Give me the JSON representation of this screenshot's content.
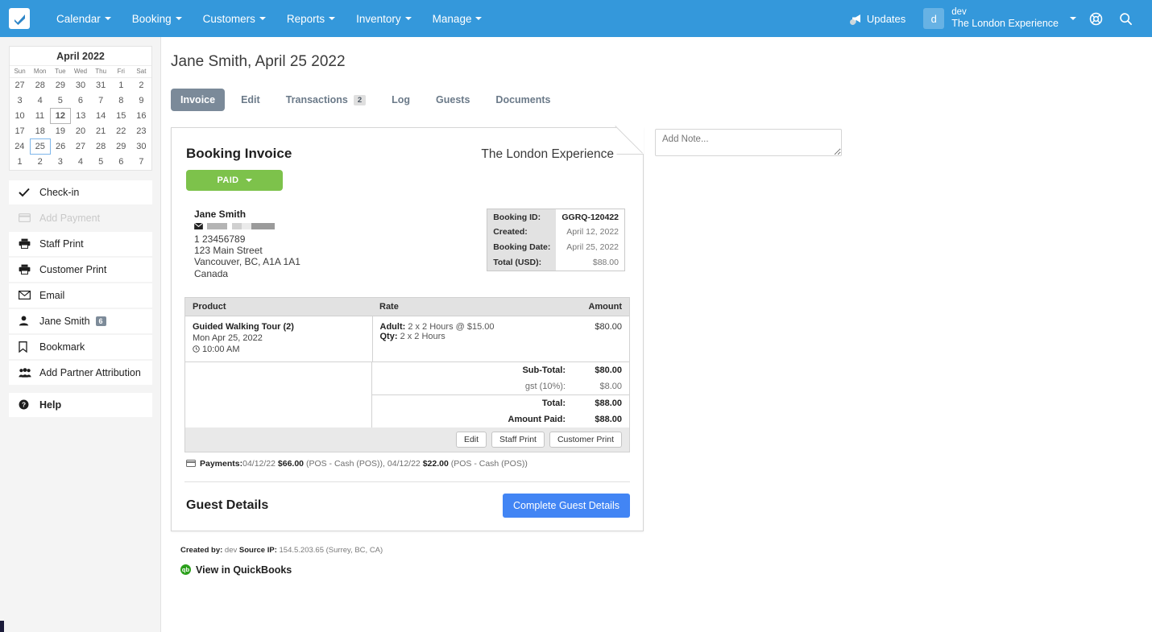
{
  "topnav": {
    "logo_icon": "checkmark-logo",
    "items": [
      {
        "label": "Calendar",
        "caret": true
      },
      {
        "label": "Booking",
        "caret": true
      },
      {
        "label": "Customers",
        "caret": true
      },
      {
        "label": "Reports",
        "caret": true
      },
      {
        "label": "Inventory",
        "caret": true
      },
      {
        "label": "Manage",
        "caret": true
      }
    ],
    "updates_label": "Updates",
    "updates_icon": "megaphone-icon",
    "avatar_initial": "d",
    "user_name": "dev",
    "user_org": "The London Experience",
    "globe_icon": "globe-help-icon",
    "search_icon": "search-icon",
    "background": "#3498db"
  },
  "sidebar": {
    "calendar": {
      "title": "April 2022",
      "weekdays": [
        "Sun",
        "Mon",
        "Tue",
        "Wed",
        "Thu",
        "Fri",
        "Sat"
      ],
      "weeks": [
        [
          {
            "d": "27"
          },
          {
            "d": "28"
          },
          {
            "d": "29"
          },
          {
            "d": "30"
          },
          {
            "d": "31"
          },
          {
            "d": "1"
          },
          {
            "d": "2"
          }
        ],
        [
          {
            "d": "3"
          },
          {
            "d": "4"
          },
          {
            "d": "5"
          },
          {
            "d": "6"
          },
          {
            "d": "7"
          },
          {
            "d": "8"
          },
          {
            "d": "9"
          }
        ],
        [
          {
            "d": "10"
          },
          {
            "d": "11"
          },
          {
            "d": "12",
            "state": "today"
          },
          {
            "d": "13"
          },
          {
            "d": "14"
          },
          {
            "d": "15"
          },
          {
            "d": "16"
          }
        ],
        [
          {
            "d": "17"
          },
          {
            "d": "18"
          },
          {
            "d": "19"
          },
          {
            "d": "20"
          },
          {
            "d": "21"
          },
          {
            "d": "22"
          },
          {
            "d": "23"
          }
        ],
        [
          {
            "d": "24"
          },
          {
            "d": "25",
            "state": "selected"
          },
          {
            "d": "26"
          },
          {
            "d": "27"
          },
          {
            "d": "28"
          },
          {
            "d": "29"
          },
          {
            "d": "30"
          }
        ],
        [
          {
            "d": "1"
          },
          {
            "d": "2"
          },
          {
            "d": "3"
          },
          {
            "d": "4"
          },
          {
            "d": "5"
          },
          {
            "d": "6"
          },
          {
            "d": "7"
          }
        ]
      ]
    },
    "items": [
      {
        "label": "Check-in",
        "icon": "check-icon",
        "disabled": false
      },
      {
        "label": "Add Payment",
        "icon": "credit-card-icon",
        "disabled": true
      },
      {
        "label": "Staff Print",
        "icon": "printer-icon",
        "disabled": false
      },
      {
        "label": "Customer Print",
        "icon": "printer-icon",
        "disabled": false
      },
      {
        "label": "Email",
        "icon": "envelope-icon",
        "disabled": false
      },
      {
        "label": "Jane Smith",
        "icon": "user-icon",
        "disabled": false,
        "badge": "6"
      },
      {
        "label": "Bookmark",
        "icon": "bookmark-icon",
        "disabled": false
      },
      {
        "label": "Add Partner Attribution",
        "icon": "group-icon",
        "disabled": false
      }
    ],
    "help": {
      "label": "Help",
      "icon": "question-circle-icon"
    }
  },
  "page": {
    "title": "Jane Smith, April 25 2022",
    "tabs": [
      {
        "label": "Invoice",
        "active": true
      },
      {
        "label": "Edit",
        "active": false
      },
      {
        "label": "Transactions",
        "active": false,
        "badge": "2"
      },
      {
        "label": "Log",
        "active": false
      },
      {
        "label": "Guests",
        "active": false
      },
      {
        "label": "Documents",
        "active": false
      }
    ]
  },
  "invoice": {
    "heading": "Booking Invoice",
    "business_name": "The London Experience",
    "status_button": {
      "label": "PAID",
      "color": "#7dc24b"
    },
    "customer": {
      "name": "Jane Smith",
      "email_redacted": true,
      "phone": "1 23456789",
      "street": "123 Main Street",
      "city_line": "Vancouver, BC, A1A 1A1",
      "country": "Canada"
    },
    "booking_details": [
      {
        "key": "Booking ID:",
        "value": "GGRQ-120422",
        "strong": true
      },
      {
        "key": "Created:",
        "value": "April 12, 2022",
        "strong": false
      },
      {
        "key": "Booking Date:",
        "value": "April 25, 2022",
        "strong": false
      },
      {
        "key": "Total (USD):",
        "value": "$88.00",
        "strong": false
      }
    ],
    "line_table": {
      "headers": [
        "Product",
        "Rate",
        "Amount"
      ],
      "rows": [
        {
          "product": "Guided Walking Tour (2)",
          "date": "Mon Apr 25, 2022",
          "time": "10:00 AM",
          "rate_label_1": "Adult:",
          "rate_value_1": "2 x 2 Hours @ $15.00",
          "rate_label_2": "Qty:",
          "rate_value_2": "2 x 2 Hours",
          "amount": "$80.00"
        }
      ],
      "totals": [
        {
          "label": "Sub-Total:",
          "value": "$80.00",
          "bold": true,
          "sep": false
        },
        {
          "label": "gst (10%):",
          "value": "$8.00",
          "bold": false,
          "sep": false
        },
        {
          "label": "Total:",
          "value": "$88.00",
          "bold": true,
          "sep": true
        },
        {
          "label": "Amount Paid:",
          "value": "$88.00",
          "bold": true,
          "sep": false
        }
      ]
    },
    "actions": [
      {
        "label": "Edit"
      },
      {
        "label": "Staff Print"
      },
      {
        "label": "Customer Print"
      }
    ],
    "payments": {
      "icon": "credit-card-icon",
      "label": "Payments:",
      "entries": [
        {
          "date": "04/12/22",
          "amount": "$66.00",
          "method": "(POS - Cash (POS))"
        },
        {
          "date": "04/12/22",
          "amount": "$22.00",
          "method": "(POS - Cash (POS))"
        }
      ]
    },
    "guest_section": {
      "heading": "Guest Details",
      "button_label": "Complete Guest Details"
    }
  },
  "note": {
    "placeholder": "Add Note...",
    "value": ""
  },
  "footer": {
    "created_by_label": "Created by:",
    "created_by_value": "dev",
    "source_ip_label": "Source IP:",
    "source_ip_value": "154.5.203.65 (Surrey, BC, CA)",
    "quickbooks_label": "View in QuickBooks",
    "quickbooks_icon": "quickbooks-icon"
  }
}
